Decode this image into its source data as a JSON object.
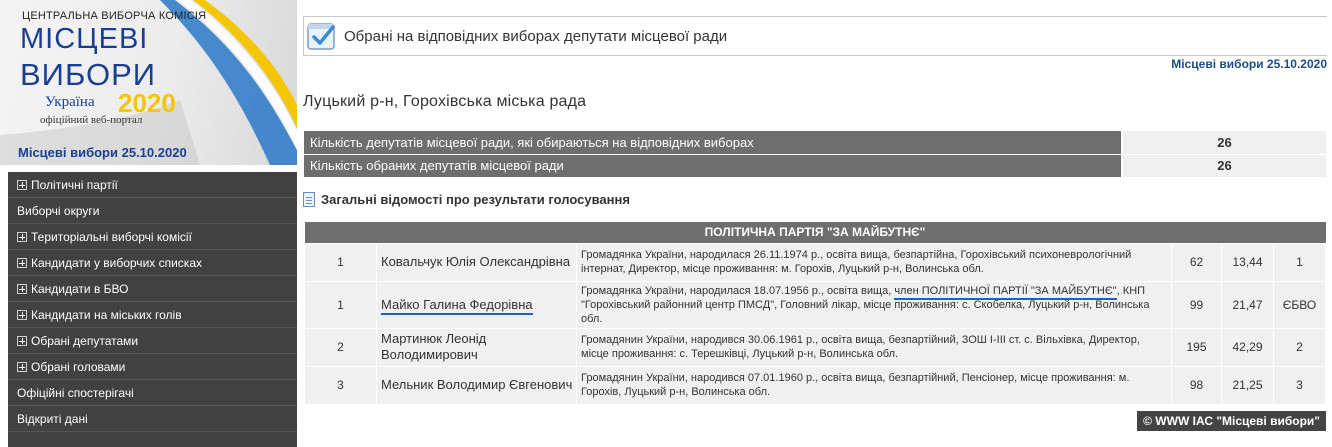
{
  "banner": {
    "commission": "ЦЕНТРАЛЬНА ВИБОРЧА КОМІСІЯ",
    "title_line1": "МІСЦЕВІ",
    "title_line2": "ВИБОРИ",
    "country": "Україна",
    "year": "2020",
    "portal": "офіційний веб-портал",
    "date_link": "Місцеві вибори 25.10.2020"
  },
  "menu": [
    {
      "label": "Політичні партії",
      "expandable": true
    },
    {
      "label": "Виборчі округи",
      "expandable": false
    },
    {
      "label": "Територіальні виборчі комісії",
      "expandable": true
    },
    {
      "label": "Кандидати у виборчих списках",
      "expandable": true
    },
    {
      "label": "Кандидати в БВО",
      "expandable": true
    },
    {
      "label": "Кандидати на міських голів",
      "expandable": true
    },
    {
      "label": "Обрані депутатами",
      "expandable": true
    },
    {
      "label": "Обрані головами",
      "expandable": true
    },
    {
      "label": "Офіційні спостерігачі",
      "expandable": false
    },
    {
      "label": "Відкриті дані",
      "expandable": false
    }
  ],
  "header": {
    "title": "Обрані на відповідних виборах депутати місцевої ради",
    "election_link": "Місцеві вибори 25.10.2020"
  },
  "area_title": "Луцький р-н, Горохівська міська рада",
  "summary": [
    {
      "label": "Кількість депутатів місцевої ради, які обираються на відповідних виборах",
      "value": "26"
    },
    {
      "label": "Кількість обраних депутатів місцевої ради",
      "value": "26"
    }
  ],
  "voting_link": "Загальні відомості про результати голосування",
  "party": {
    "name": "ПОЛІТИЧНА ПАРТІЯ \"ЗА МАЙБУТНЄ\"",
    "rows": [
      {
        "district": "1",
        "name": "Ковальчук Юлія Олександрівна",
        "bio": "Громадянка України, народилася 26.11.1974 р., освіта вища, безпартійна, Горохівський психоневрологічний інтернат, Директор, місце проживання: м. Горохів, Луцький р-н, Волинська обл.",
        "votes": "62",
        "percent": "13,44",
        "rank": "1"
      },
      {
        "district": "1",
        "name": "Майко Галина Федорівна",
        "bio_pre": "Громадянка України, народилася 18.07.1956 р., освіта вища, ",
        "bio_highlight": "член ПОЛІТИЧНОЇ ПАРТІЇ \"ЗА МАЙБУТНЄ\"",
        "bio_post": ", КНП \"Горохівський районний центр ПМСД\", Головний лікар, місце проживання: с. Скобелка, Луцький р-н, Волинська обл.",
        "votes": "99",
        "percent": "21,47",
        "rank": "ЄБВО"
      },
      {
        "district": "2",
        "name": "Мартинюк Леонід Володимирович",
        "bio": "Громадянин України, народився 30.06.1961 р., освіта вища, безпартійний, ЗОШ І-ІІІ ст. с. Вільхівка, Директор, місце проживання: с. Терешківці, Луцький р-н, Волинська обл.",
        "votes": "195",
        "percent": "42,29",
        "rank": "2"
      },
      {
        "district": "3",
        "name": "Мельник Володимир Євгенович",
        "bio": "Громадянин України, народився 07.01.1960 р., освіта вища, безпартійний, Пенсіонер, місце проживання: м. Горохів, Луцький р-н, Волинська обл.",
        "votes": "98",
        "percent": "21,25",
        "rank": "3"
      }
    ]
  },
  "copyright": "© WWW ІАС \"Місцеві вибори\"",
  "colors": {
    "brand_blue": "#1b3f8f",
    "accent_yellow": "#f3c600",
    "menu_bg": "#414141",
    "header_grey": "#6e6e6e",
    "underline_blue": "#1f63b6"
  }
}
